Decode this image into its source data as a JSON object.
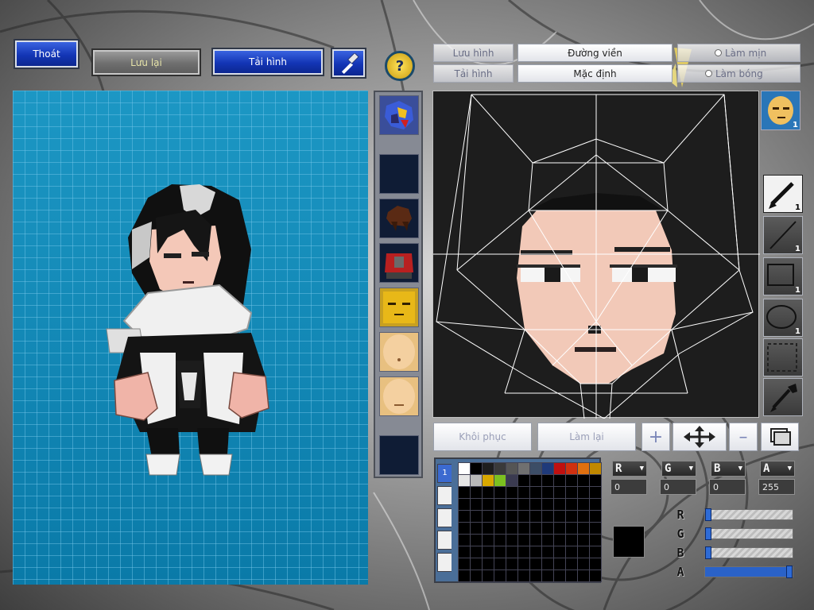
{
  "toolbar_left": {
    "exit_label": "Thoát",
    "save_label": "Lưu lại",
    "load_label": "Tải hình",
    "help_glyph": "?"
  },
  "editor_toolbar": {
    "save_image_label": "Lưu hình",
    "load_image_label": "Tải hình",
    "outline_label": "Đường viền",
    "default_label": "Mặc định",
    "smooth_label": "Làm mịn",
    "shade_label": "Làm bóng"
  },
  "parts": [
    {
      "name": "bird-mount"
    },
    {
      "name": "empty"
    },
    {
      "name": "hair"
    },
    {
      "name": "armor"
    },
    {
      "name": "face-yellow"
    },
    {
      "name": "face-skin-1"
    },
    {
      "name": "face-skin-2"
    },
    {
      "name": "empty"
    }
  ],
  "layer_badge": "1",
  "tools": [
    {
      "name": "pen",
      "num": "1"
    },
    {
      "name": "line",
      "num": "1"
    },
    {
      "name": "rectangle",
      "num": "1"
    },
    {
      "name": "ellipse",
      "num": "1"
    },
    {
      "name": "select",
      "num": ""
    },
    {
      "name": "eyedropper",
      "num": ""
    }
  ],
  "action_buttons": {
    "restore_label": "Khôi phục",
    "redo_label": "Làm lại"
  },
  "palette": {
    "tab_active_label": "1",
    "swatches": [
      "#ffffff",
      "#000000",
      "#1e1e1e",
      "#3a3a3a",
      "#555555",
      "#707070",
      "#3c4d66",
      "#1f3a7a",
      "#c01010",
      "#d03010",
      "#e07010",
      "#c08800",
      "#e6e6e6",
      "#b8b8b8",
      "#d8a800",
      "#7cc020",
      "#3a3a50"
    ]
  },
  "color": {
    "r": "0",
    "g": "0",
    "b": "0",
    "a": "255",
    "current": "#000000",
    "r_level": 0.0,
    "g_level": 0.0,
    "b_level": 0.0,
    "a_level": 1.0
  },
  "colors": {
    "accent_blue": "#1a3fc4",
    "canvas_blue": "#0f86b6",
    "editor_bg": "#1d1d1d"
  }
}
